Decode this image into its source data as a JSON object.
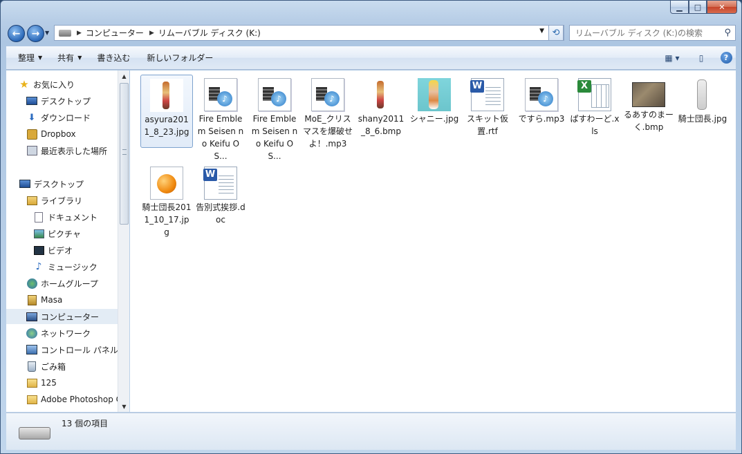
{
  "address": {
    "crumbs": [
      "コンピューター",
      "リムーバブル ディスク (K:)"
    ]
  },
  "search": {
    "placeholder": "リムーバブル ディスク (K:)の検索"
  },
  "toolbar": {
    "organize": "整理",
    "share": "共有",
    "burn": "書き込む",
    "new_folder": "新しいフォルダー"
  },
  "nav": {
    "favorites": "お気に入り",
    "fav_items": [
      "デスクトップ",
      "ダウンロード",
      "Dropbox",
      "最近表示した場所"
    ],
    "desktop": "デスクトップ",
    "libraries": "ライブラリ",
    "lib_items": [
      "ドキュメント",
      "ピクチャ",
      "ビデオ",
      "ミュージック"
    ],
    "homegroup": "ホームグループ",
    "user": "Masa",
    "computer": "コンピューター",
    "network": "ネットワーク",
    "control_panel": "コントロール パネル",
    "trash": "ごみ箱",
    "folder_125": "125",
    "photoshop": "Adobe Photoshop C"
  },
  "files": [
    {
      "name": "asyura2011_8_23.jpg",
      "type": "image-figure"
    },
    {
      "name": "Fire Emblem Seisen no Keifu OS...",
      "type": "media"
    },
    {
      "name": "Fire Emblem Seisen no Keifu OS...",
      "type": "media"
    },
    {
      "name": "MoE_クリスマスを爆破せよ！.mp3",
      "type": "media"
    },
    {
      "name": "shany2011_8_6.bmp",
      "type": "image-figure"
    },
    {
      "name": "シャニー.jpg",
      "type": "image-cyan"
    },
    {
      "name": "スキット仮置.rtf",
      "type": "word"
    },
    {
      "name": "ですら.mp3",
      "type": "media"
    },
    {
      "name": "ぱすわーど.xls",
      "type": "excel"
    },
    {
      "name": "るあすのまーく.bmp",
      "type": "photo"
    },
    {
      "name": "騎士団長.jpg",
      "type": "sketch"
    },
    {
      "name": "騎士団長2011_10_17.jpg",
      "type": "orb"
    },
    {
      "name": "告別式挨拶.doc",
      "type": "word"
    }
  ],
  "status": {
    "item_count": "13 個の項目"
  }
}
